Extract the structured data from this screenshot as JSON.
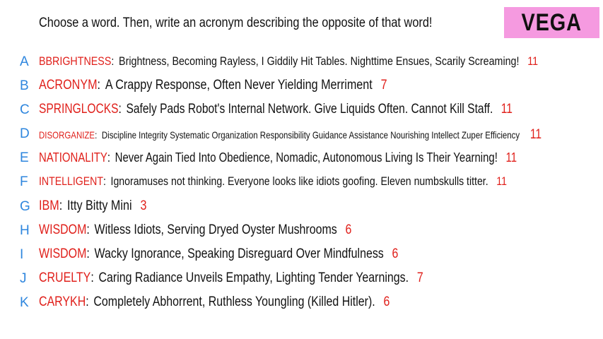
{
  "prompt": "Choose a word. Then, write an acronym describing the opposite of that word!",
  "badge": "VEGA",
  "rows": [
    {
      "letter": "A",
      "word": "BBRIGHTNESS",
      "acronym": "Brightness, Becoming Rayless, I Giddily Hit Tables. Nighttime Ensues, Scarily Screaming!",
      "count": "11"
    },
    {
      "letter": "B",
      "word": "ACRONYM",
      "acronym": "A Crappy Response, Often Never Yielding Merriment",
      "count": "7"
    },
    {
      "letter": "C",
      "word": "SPRINGLOCKS",
      "acronym": "Safely Pads Robot's Internal Network. Give Liquids Often. Cannot Kill Staff.",
      "count": "11"
    },
    {
      "letter": "D",
      "word": "DISORGANIZE",
      "acronym": "Discipline Integrity Systematic Organization Responsibility Guidance Assistance Nourishing Intellect Zuper Efficiency",
      "count": "11"
    },
    {
      "letter": "E",
      "word": "NATIONALITY",
      "acronym": "Never Again Tied Into Obedience, Nomadic, Autonomous Living Is Their Yearning!",
      "count": "11"
    },
    {
      "letter": "F",
      "word": "INTELLIGENT",
      "acronym": "Ignoramuses not thinking. Everyone looks like idiots goofing. Eleven numbskulls titter.",
      "count": "11"
    },
    {
      "letter": "G",
      "word": "IBM",
      "acronym": "Itty Bitty Mini",
      "count": "3"
    },
    {
      "letter": "H",
      "word": "WISDOM",
      "acronym": "Witless Idiots, Serving Dryed Oyster Mushrooms",
      "count": "6"
    },
    {
      "letter": "I",
      "word": "WISDOM",
      "acronym": "Wacky Ignorance, Speaking Disreguard Over Mindfulness",
      "count": "6"
    },
    {
      "letter": "J",
      "word": "CRUELTY",
      "acronym": "Caring Radiance Unveils Empathy, Lighting Tender Yearnings.",
      "count": "7"
    },
    {
      "letter": "K",
      "word": "CARYKH",
      "acronym": "Completely Abhorrent, Ruthless Youngling (Killed Hitler).",
      "count": "6"
    }
  ]
}
